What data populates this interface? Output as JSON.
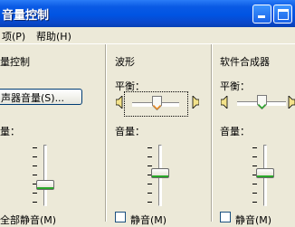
{
  "window": {
    "title": "音量控制"
  },
  "menu": {
    "items": [
      "项(P)",
      "帮助(H)"
    ]
  },
  "panels": [
    {
      "title": "量控制",
      "button": "声器音量(S)...",
      "volume_label": "量：",
      "mute_label": "全部静音(M)"
    },
    {
      "title": "波形",
      "balance_label": "平衡：",
      "volume_label": "音量：",
      "mute_label": "静音(M)"
    },
    {
      "title": "软件合成器",
      "balance_label": "平衡：",
      "volume_label": "音量：",
      "mute_label": "静音(M)"
    }
  ]
}
